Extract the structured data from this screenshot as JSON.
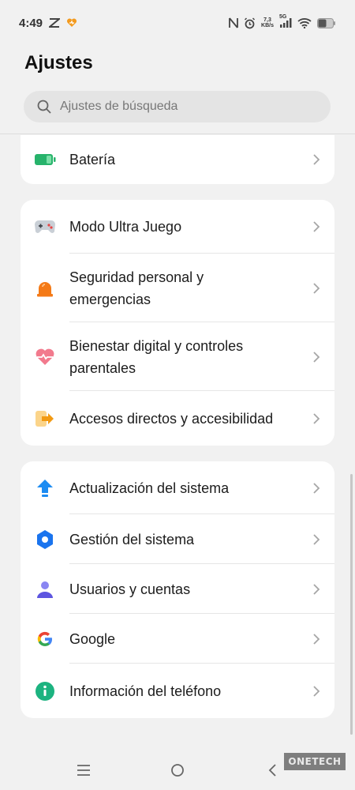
{
  "status_bar": {
    "time": "4:49",
    "speed_value": "7,3",
    "speed_unit": "KB/s",
    "network": "5G"
  },
  "header": {
    "title": "Ajustes",
    "search_placeholder": "Ajustes de búsqueda"
  },
  "cards": [
    {
      "items": [
        {
          "label": "Batería",
          "icon": "battery-icon",
          "color": "#2db36a"
        }
      ]
    },
    {
      "items": [
        {
          "label": "Modo Ultra Juego",
          "icon": "gamepad-icon",
          "color": "#9aa3ad"
        },
        {
          "label": "Seguridad personal y\nemergencias",
          "icon": "siren-icon",
          "color": "#f07a1a"
        },
        {
          "label": "Bienestar digital y controles\nparentales",
          "icon": "heart-icon",
          "color": "#f06478"
        },
        {
          "label": "Accesos directos y accesibilidad",
          "icon": "shortcut-icon",
          "color": "#f5a623"
        }
      ]
    },
    {
      "items": [
        {
          "label": "Actualización del sistema",
          "icon": "update-arrow-icon",
          "color": "#1d8cf0"
        },
        {
          "label": "Gestión del sistema",
          "icon": "hexagon-icon",
          "color": "#1d78f0"
        },
        {
          "label": "Usuarios y cuentas",
          "icon": "user-icon",
          "color": "#6b63e8"
        },
        {
          "label": "Google",
          "icon": "google-icon",
          "color": "#4285f4"
        },
        {
          "label": "Información del teléfono",
          "icon": "info-icon",
          "color": "#1fb47f"
        }
      ]
    }
  ],
  "watermark": "ONETECH"
}
